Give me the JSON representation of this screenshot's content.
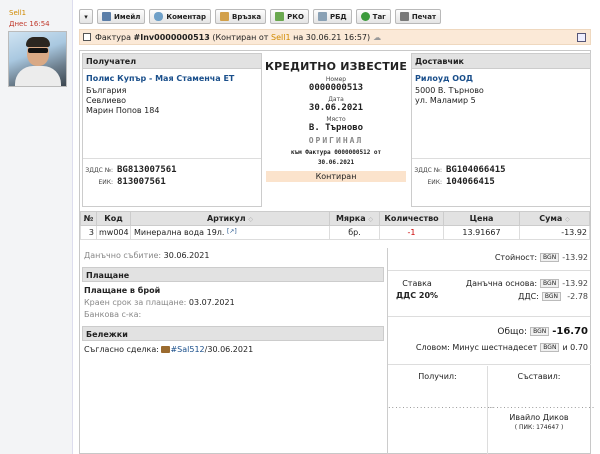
{
  "sidebar": {
    "user": "Sell1",
    "when": "Днес 16:54"
  },
  "toolbar": {
    "email": "Имейл",
    "comment": "Коментар",
    "link": "Връзка",
    "rko": "РКО",
    "rbd": "РБД",
    "tag": "Таг",
    "print": "Печат"
  },
  "header": {
    "prefix": "Фактура",
    "number": "#Inv0000000513",
    "status_open": "(Контиран от",
    "user": "Sell1",
    "on": "на 30.06.21 16:57)"
  },
  "recipient": {
    "title": "Получател",
    "name": "Полис Купър - Мая Стаменча ЕТ",
    "country": "България",
    "city": "Севлиево",
    "address": "Марин Попов 184",
    "vat_label": "ЗДДС №:",
    "vat": "BG813007561",
    "eik_label": "ЕИК:",
    "eik": "813007561"
  },
  "document": {
    "title": "КРЕДИТНО ИЗВЕСТИЕ",
    "number_label": "Номер",
    "number": "0000000513",
    "date_label": "Дата",
    "date": "30.06.2021",
    "place_label": "Място",
    "place": "В. Търново",
    "original": "ОРИГИНАЛ",
    "ref_line1": "към Фактура 0000000512 от",
    "ref_line2": "30.06.2021",
    "state": "Контиран"
  },
  "supplier": {
    "title": "Доставчик",
    "name": "Рилоуд ООД",
    "city": "5000 В. Търново",
    "address": "ул. Маламир 5",
    "vat_label": "ЗДДС №:",
    "vat": "BG104066415",
    "eik_label": "ЕИК:",
    "eik": "104066415"
  },
  "items": {
    "headers": {
      "no": "№",
      "code": "Код",
      "article": "Артикул",
      "unit": "Мярка",
      "qty": "Количество",
      "price": "Цена",
      "sum": "Сума"
    },
    "rows": [
      {
        "no": "3",
        "code": "mw004",
        "article": "Минерална вода 19л.",
        "ext": "[↗]",
        "unit": "бр.",
        "qty": "-1",
        "price": "13.91667",
        "sum": "-13.92"
      }
    ]
  },
  "info": {
    "tax_event_label": "Данъчно събитие:",
    "tax_event": "30.06.2021",
    "payment_title": "Плащане",
    "payment_method": "Плащане в брой",
    "due_label": "Краен срок за плащане:",
    "due": "03.07.2021",
    "bank_label": "Банкова с-ка:",
    "notes_title": "Бележки",
    "deal_label": "Съгласно сделка:",
    "deal_link": "#Sal512",
    "deal_date": "/30.06.2021"
  },
  "totals": {
    "currency": "BGN",
    "value_label": "Стойност:",
    "value": "-13.92",
    "rate_label": "Ставка",
    "rate": "ДДС 20%",
    "base_label": "Данъчна основа:",
    "base": "-13.92",
    "vat_label": "ДДС:",
    "vat": "-2.78",
    "total_label": "Общо:",
    "total": "-16.70",
    "words_label": "Словом: Минус шестнадесет",
    "words_tail": "и 0.70"
  },
  "signatures": {
    "received_label": "Получил:",
    "compiled_label": "Съставил:",
    "dots": "..............................",
    "compiler_name": "Ивайло Диков",
    "compiler_pik": "( ПИК: 174647 )"
  }
}
